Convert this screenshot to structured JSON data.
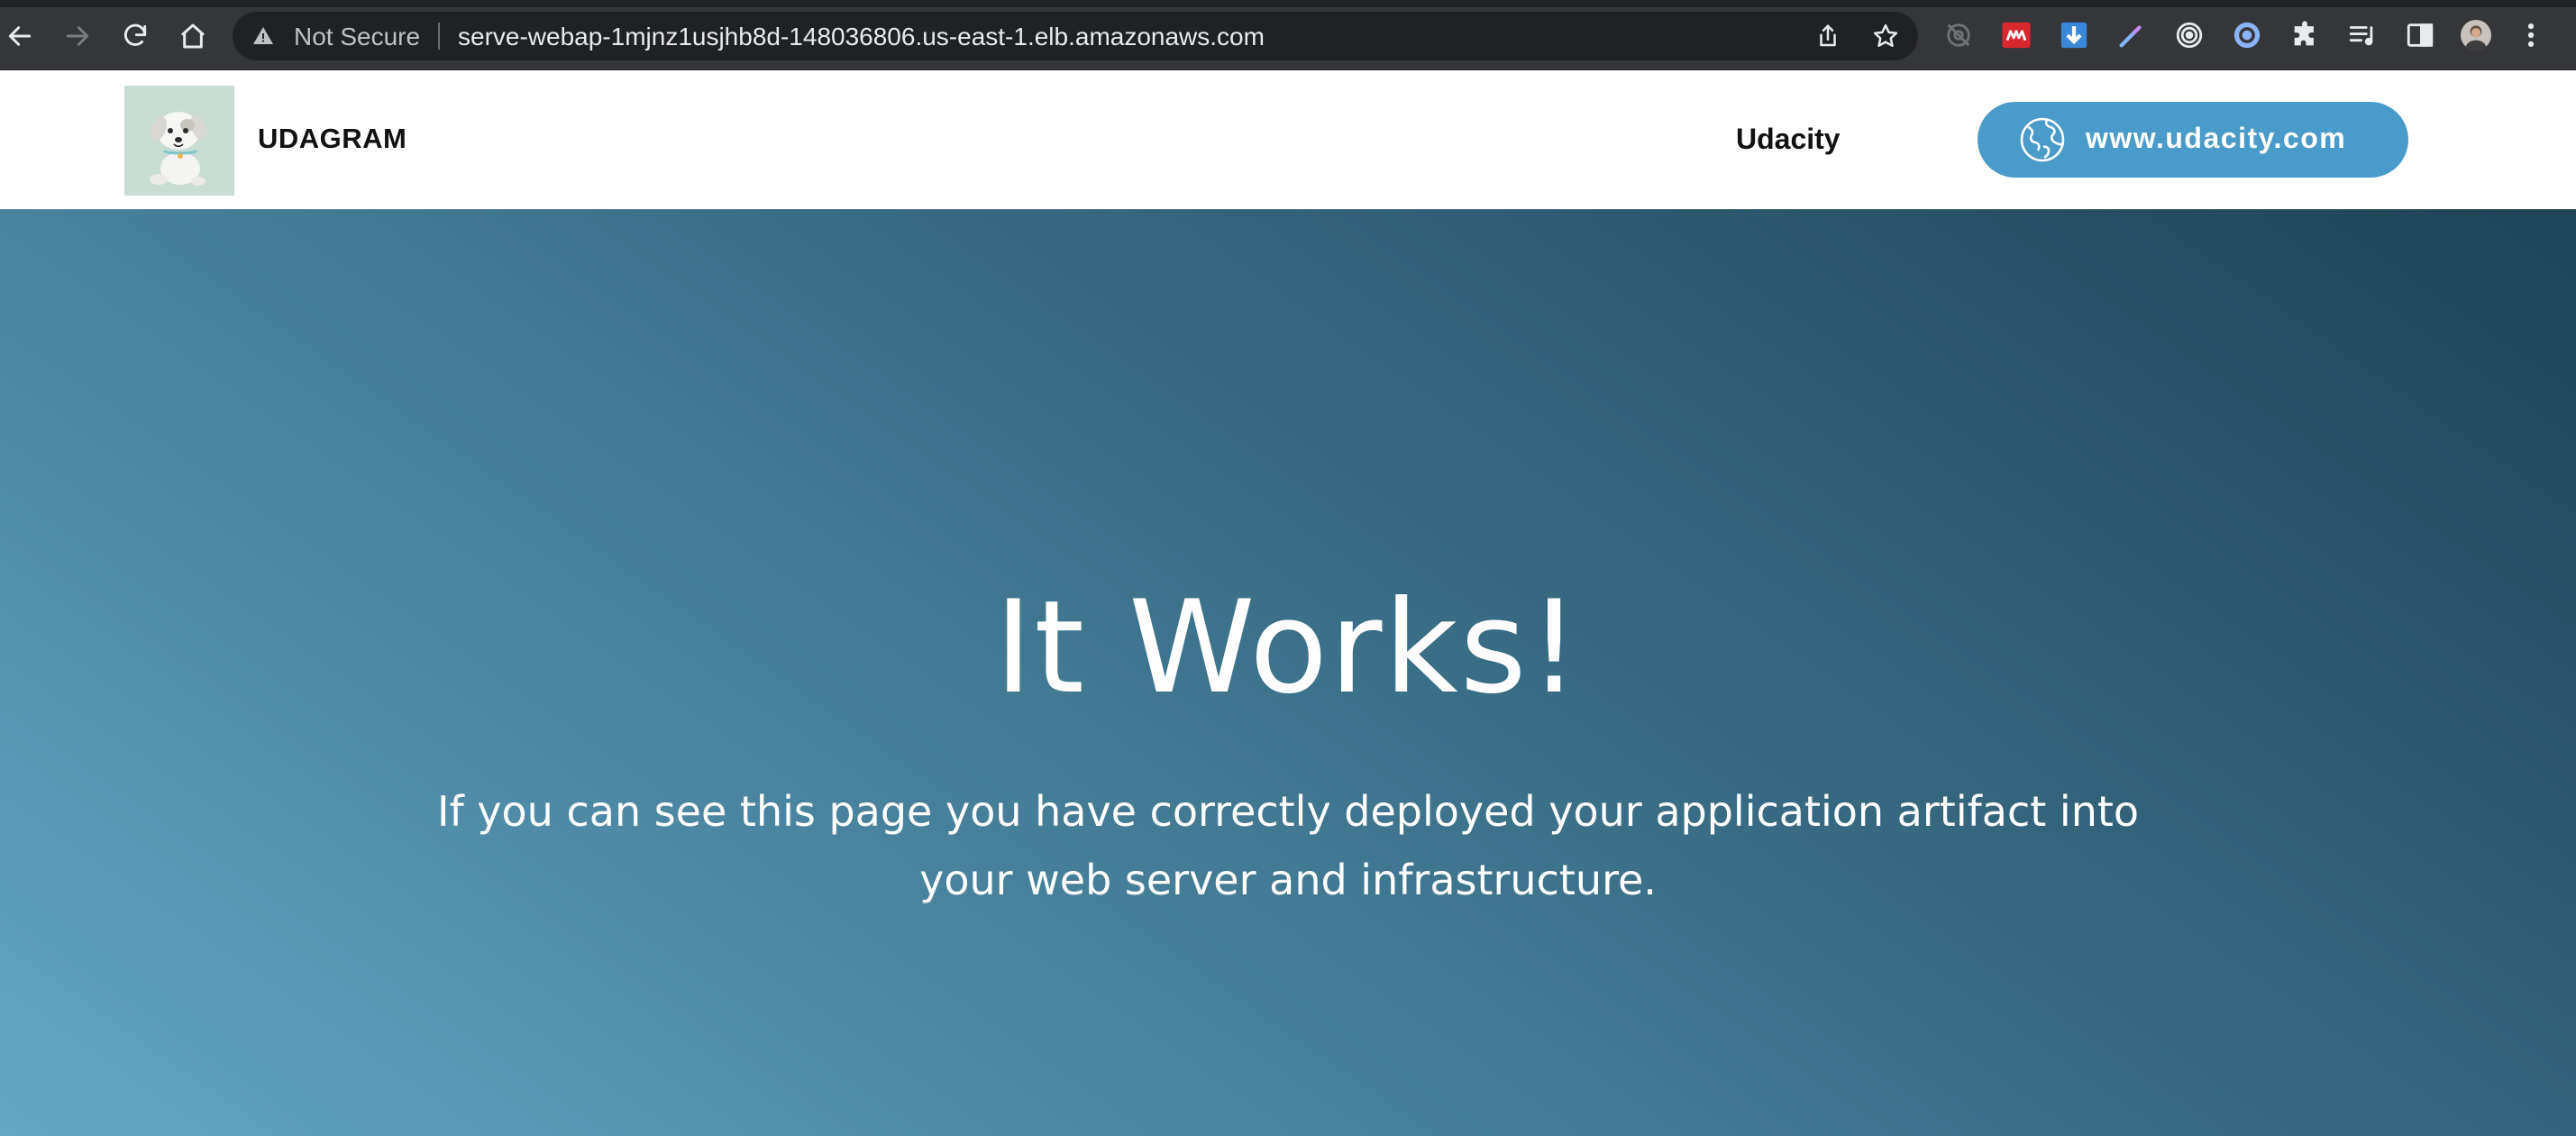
{
  "browser": {
    "security_label": "Not Secure",
    "url": "serve-webap-1mjnz1usjhb8d-148036806.us-east-1.elb.amazonaws.com",
    "nav_icons": [
      "back-icon",
      "forward-icon",
      "reload-icon",
      "home-icon"
    ],
    "omnibox_icons": [
      "warning-icon",
      "share-icon",
      "bookmark-star-icon"
    ],
    "toolbar_icons": [
      "screen-capture-extension-icon",
      "mendeley-extension-icon",
      "download-extension-icon",
      "eyedropper-extension-icon",
      "target-extension-icon",
      "circle-extension-icon",
      "extensions-puzzle-icon",
      "reading-list-icon",
      "side-panel-icon",
      "profile-avatar",
      "kebab-menu-icon"
    ]
  },
  "header": {
    "brand": "UDAGRAM",
    "nav_link": "Udacity",
    "cta_label": "www.udacity.com",
    "cta_icon": "globe-icon",
    "logo_icon": "puppy-logo"
  },
  "hero": {
    "title": "It Works!",
    "subtitle_line1": "If you can see this page you have correctly deployed your application artifact into",
    "subtitle_line2": "your web server and infrastructure."
  },
  "colors": {
    "chrome_bg": "#35363a",
    "omnibox_bg": "#202124",
    "cta_bg": "#4a9bc9",
    "hero_gradient_start": "#64a6c6",
    "hero_gradient_end": "#1f4357"
  }
}
